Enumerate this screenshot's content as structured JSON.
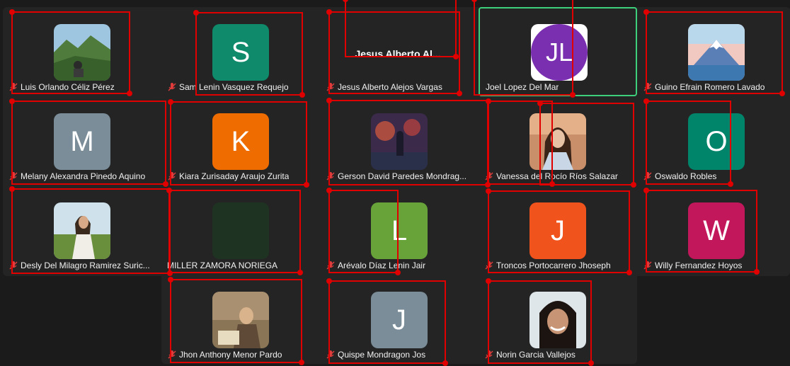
{
  "colors": {
    "active_border": "#3ecf7c",
    "tile_bg": "#242424",
    "annotation_red": "#e00000",
    "muted_mic": "#e03c3c"
  },
  "participants": [
    {
      "name": "Luis Orlando Céliz Pérez",
      "avatar_type": "photo",
      "photo": "mountain-landscape"
    },
    {
      "name": "Sam Lenin Vasquez Requejo",
      "avatar_type": "initial",
      "initial": "S",
      "color": "#0f8a6a"
    },
    {
      "name": "Jesus Alberto Alejos Vargas",
      "avatar_type": "text",
      "display_name": "Jesus Alberto Al..."
    },
    {
      "name": "Joel Lopez Del Mar",
      "avatar_type": "initial",
      "initial": "JL",
      "color": "#7a2fb0",
      "active": true
    },
    {
      "name": "Guino Efrain Romero Lavado",
      "avatar_type": "photo",
      "photo": "mount-fuji-illustration"
    },
    {
      "name": "Melany Alexandra Pinedo Aquino",
      "avatar_type": "initial",
      "initial": "M",
      "color": "#7b8d98"
    },
    {
      "name": "Kiara Zurisaday Araujo Zurita",
      "avatar_type": "initial",
      "initial": "K",
      "color": "#ef6c00"
    },
    {
      "name": "Gerson David Paredes Mondrag...",
      "avatar_type": "photo",
      "photo": "anime-night-scene"
    },
    {
      "name": "Vanessa del Rocío Ríos Salazar",
      "avatar_type": "photo",
      "photo": "woman-portrait"
    },
    {
      "name": "Oswaldo Robles",
      "avatar_type": "initial",
      "initial": "O",
      "color": "#00856a"
    },
    {
      "name": "Desly Del Milagro Ramirez Suric...",
      "avatar_type": "photo",
      "photo": "woman-in-field"
    },
    {
      "name": "MILLER ZAMORA NORIEGA",
      "avatar_type": "blank",
      "color": "#1f3322"
    },
    {
      "name": "Arévalo Díaz Lenin Jair",
      "avatar_type": "initial",
      "initial": "L",
      "color": "#67a339"
    },
    {
      "name": "Troncos Portocarrero Jhoseph",
      "avatar_type": "initial",
      "initial": "J",
      "color": "#f0531c"
    },
    {
      "name": "Willy Fernandez Hoyos",
      "avatar_type": "initial",
      "initial": "W",
      "color": "#c2185b"
    },
    {
      "name": "Jhon Anthony Menor Pardo",
      "avatar_type": "photo",
      "photo": "sepia-painting"
    },
    {
      "name": "Quispe Mondragon Jos",
      "avatar_type": "initial",
      "initial": "J",
      "color": "#7b8d98"
    },
    {
      "name": "Norin Garcia Vallejos",
      "avatar_type": "photo",
      "photo": "woman-selfie"
    }
  ]
}
